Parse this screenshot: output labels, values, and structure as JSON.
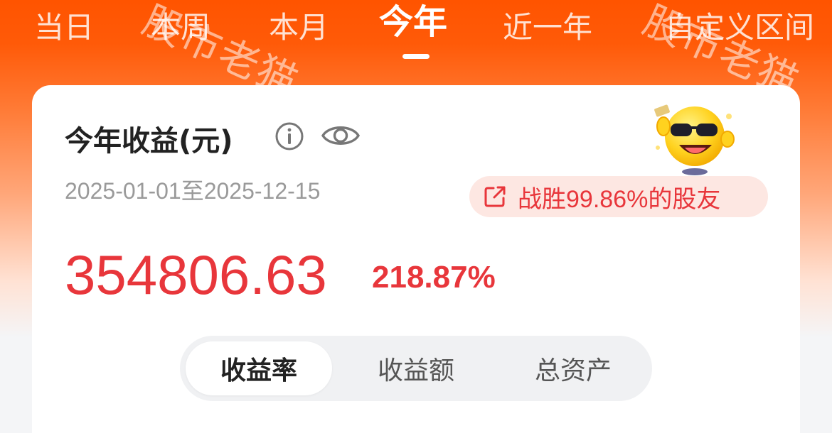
{
  "tabs": [
    {
      "label": "当日"
    },
    {
      "label": "本周"
    },
    {
      "label": "本月"
    },
    {
      "label": "今年"
    },
    {
      "label": "近一年"
    },
    {
      "label": "自定义区间"
    }
  ],
  "active_tab": "今年",
  "watermark": "股市老猫",
  "card": {
    "title": "今年收益(元)",
    "date_range": "2025-01-01至2025-12-15",
    "beat_text": "战胜99.86%的股友",
    "profit_amount": "354806.63",
    "profit_rate": "218.87%",
    "segments": [
      {
        "label": "收益率"
      },
      {
        "label": "收益额"
      },
      {
        "label": "总资产"
      }
    ],
    "active_segment": "收益率"
  },
  "colors": {
    "brand_orange": "#ff5400",
    "profit_red": "#e8363b",
    "badge_bg": "#fde7e2"
  },
  "icons": [
    "info-icon",
    "eye-icon",
    "share-icon",
    "mascot-icon"
  ]
}
